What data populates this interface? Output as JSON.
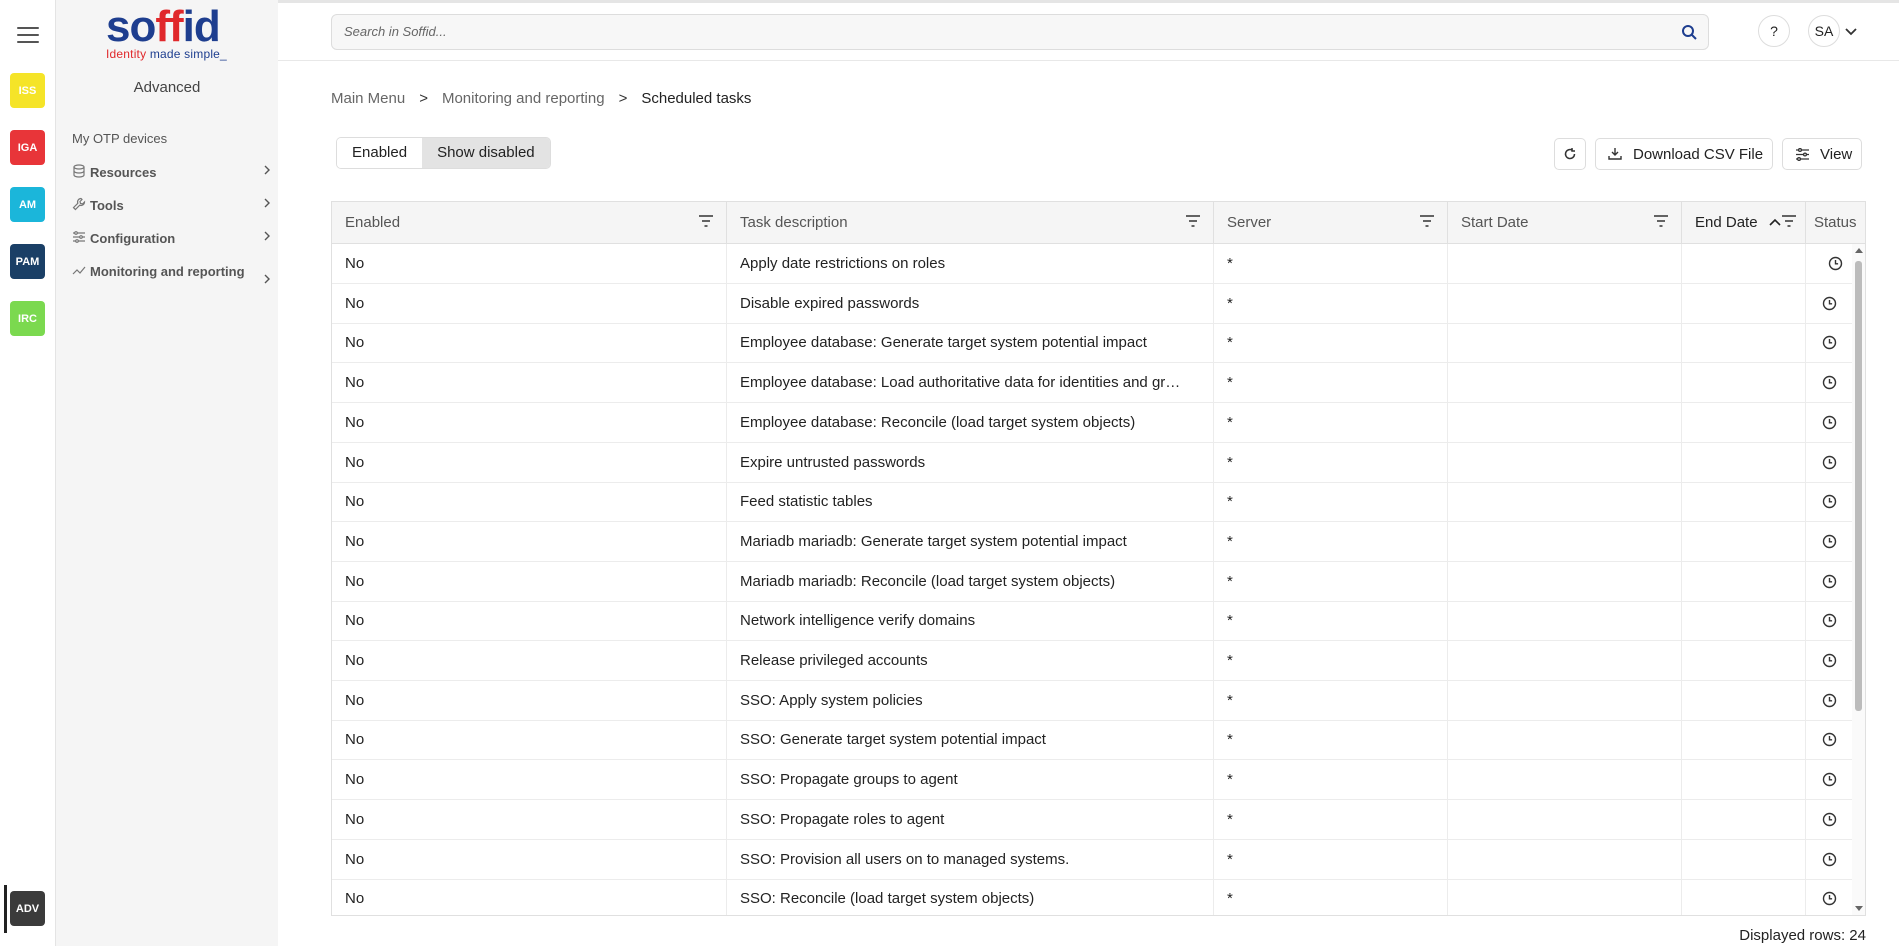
{
  "rail": {
    "apps": [
      {
        "label": "ISS",
        "color": "#f5e428"
      },
      {
        "label": "IGA",
        "color": "#e83539"
      },
      {
        "label": "AM",
        "color": "#1bb6da"
      },
      {
        "label": "PAM",
        "color": "#1a3f66"
      },
      {
        "label": "IRC",
        "color": "#7bd94f"
      }
    ],
    "active_app": {
      "label": "ADV",
      "color": "#3b3b3b"
    }
  },
  "logo": {
    "brand": "soffid",
    "tagline_red": "Identity",
    "tagline_rest": " made simple_"
  },
  "sidebar": {
    "title": "Advanced",
    "plain_item": "My OTP devices",
    "items": [
      {
        "label": "Resources",
        "icon": "database-icon"
      },
      {
        "label": "Tools",
        "icon": "wrench-icon"
      },
      {
        "label": "Configuration",
        "icon": "sliders-icon"
      },
      {
        "label": "Monitoring and reporting",
        "icon": "chart-line-icon"
      }
    ]
  },
  "header": {
    "search_placeholder": "Search in Soffid...",
    "help_label": "?",
    "user_initials": "SA"
  },
  "breadcrumb": {
    "items": [
      "Main Menu",
      "Monitoring and reporting"
    ],
    "current": "Scheduled tasks",
    "separator": ">"
  },
  "toggle": {
    "enabled_label": "Enabled",
    "show_disabled_label": "Show disabled",
    "selected": "Show disabled"
  },
  "toolbar": {
    "download_label": "Download CSV File",
    "view_label": "View"
  },
  "grid": {
    "columns": [
      "Enabled",
      "Task description",
      "Server",
      "Start Date",
      "End Date",
      "Status"
    ],
    "sorted_column": "End Date",
    "sort_direction": "ascending",
    "rows": [
      {
        "enabled": "No",
        "task": "Apply date restrictions on roles",
        "server": "*",
        "start": "",
        "end": ""
      },
      {
        "enabled": "No",
        "task": "Disable expired passwords",
        "server": "*",
        "start": "",
        "end": ""
      },
      {
        "enabled": "No",
        "task": "Employee database: Generate target system potential impact",
        "server": "*",
        "start": "",
        "end": ""
      },
      {
        "enabled": "No",
        "task": "Employee database: Load authoritative data for identities and gr…",
        "server": "*",
        "start": "",
        "end": ""
      },
      {
        "enabled": "No",
        "task": "Employee database: Reconcile (load target system objects)",
        "server": "*",
        "start": "",
        "end": ""
      },
      {
        "enabled": "No",
        "task": "Expire untrusted passwords",
        "server": "*",
        "start": "",
        "end": ""
      },
      {
        "enabled": "No",
        "task": "Feed statistic tables",
        "server": "*",
        "start": "",
        "end": ""
      },
      {
        "enabled": "No",
        "task": "Mariadb mariadb: Generate target system potential impact",
        "server": "*",
        "start": "",
        "end": ""
      },
      {
        "enabled": "No",
        "task": "Mariadb mariadb: Reconcile (load target system objects)",
        "server": "*",
        "start": "",
        "end": ""
      },
      {
        "enabled": "No",
        "task": "Network intelligence verify domains",
        "server": "*",
        "start": "",
        "end": ""
      },
      {
        "enabled": "No",
        "task": "Release privileged accounts",
        "server": "*",
        "start": "",
        "end": ""
      },
      {
        "enabled": "No",
        "task": "SSO: Apply system policies",
        "server": "*",
        "start": "",
        "end": ""
      },
      {
        "enabled": "No",
        "task": "SSO: Generate target system potential impact",
        "server": "*",
        "start": "",
        "end": ""
      },
      {
        "enabled": "No",
        "task": "SSO: Propagate groups to agent",
        "server": "*",
        "start": "",
        "end": ""
      },
      {
        "enabled": "No",
        "task": "SSO: Propagate roles to agent",
        "server": "*",
        "start": "",
        "end": ""
      },
      {
        "enabled": "No",
        "task": "SSO: Provision all users on to managed systems.",
        "server": "*",
        "start": "",
        "end": ""
      },
      {
        "enabled": "No",
        "task": "SSO: Reconcile (load target system objects)",
        "server": "*",
        "start": "",
        "end": ""
      }
    ]
  },
  "footer": {
    "displayed_rows": "Displayed rows: 24"
  }
}
